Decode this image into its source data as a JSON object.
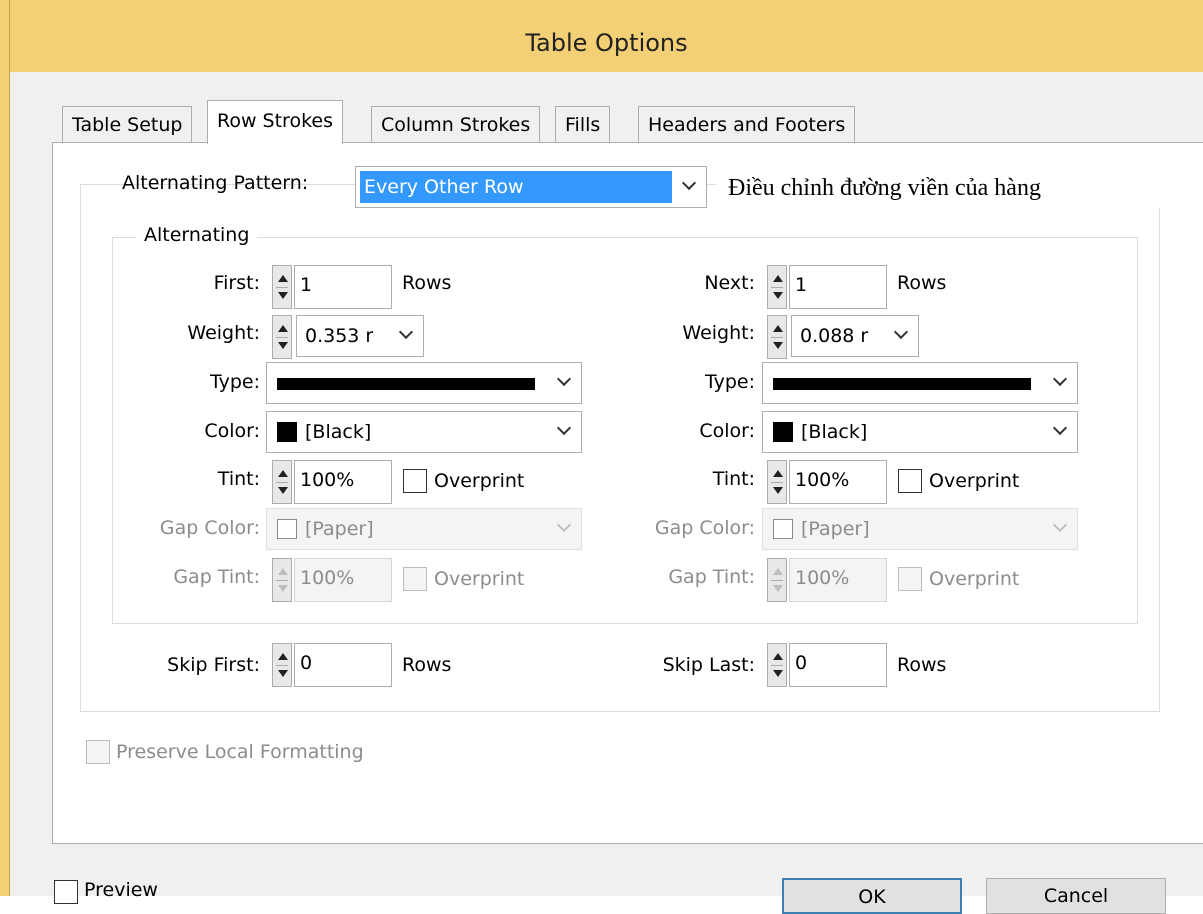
{
  "window": {
    "title": "Table Options"
  },
  "tabs": [
    {
      "label": "Table Setup"
    },
    {
      "label": "Row Strokes"
    },
    {
      "label": "Column Strokes"
    },
    {
      "label": "Fills"
    },
    {
      "label": "Headers and Footers"
    }
  ],
  "pattern": {
    "label": "Alternating Pattern:",
    "value": "Every Other Row"
  },
  "annotation": "Điều chỉnh đường viền của hàng",
  "alternating": {
    "title": "Alternating",
    "left": {
      "count_label": "First:",
      "count_value": "1",
      "count_unit": "Rows",
      "weight_label": "Weight:",
      "weight_value": "0.353 r",
      "type_label": "Type:",
      "color_label": "Color:",
      "color_value": "[Black]",
      "tint_label": "Tint:",
      "tint_value": "100%",
      "overprint_label": "Overprint",
      "gap_color_label": "Gap Color:",
      "gap_color_value": "[Paper]",
      "gap_tint_label": "Gap Tint:",
      "gap_tint_value": "100%",
      "gap_overprint_label": "Overprint"
    },
    "right": {
      "count_label": "Next:",
      "count_value": "1",
      "count_unit": "Rows",
      "weight_label": "Weight:",
      "weight_value": "0.088 r",
      "type_label": "Type:",
      "color_label": "Color:",
      "color_value": "[Black]",
      "tint_label": "Tint:",
      "tint_value": "100%",
      "overprint_label": "Overprint",
      "gap_color_label": "Gap Color:",
      "gap_color_value": "[Paper]",
      "gap_tint_label": "Gap Tint:",
      "gap_tint_value": "100%",
      "gap_overprint_label": "Overprint"
    }
  },
  "skip": {
    "first_label": "Skip First:",
    "first_value": "0",
    "first_unit": "Rows",
    "last_label": "Skip Last:",
    "last_value": "0",
    "last_unit": "Rows"
  },
  "preserve_label": "Preserve Local Formatting",
  "footer": {
    "preview_label": "Preview",
    "ok_label": "OK",
    "cancel_label": "Cancel"
  },
  "colors": {
    "titlebar": "#f3cf76",
    "selection": "#3399ff",
    "default_button_border": "#3c7fb1"
  }
}
